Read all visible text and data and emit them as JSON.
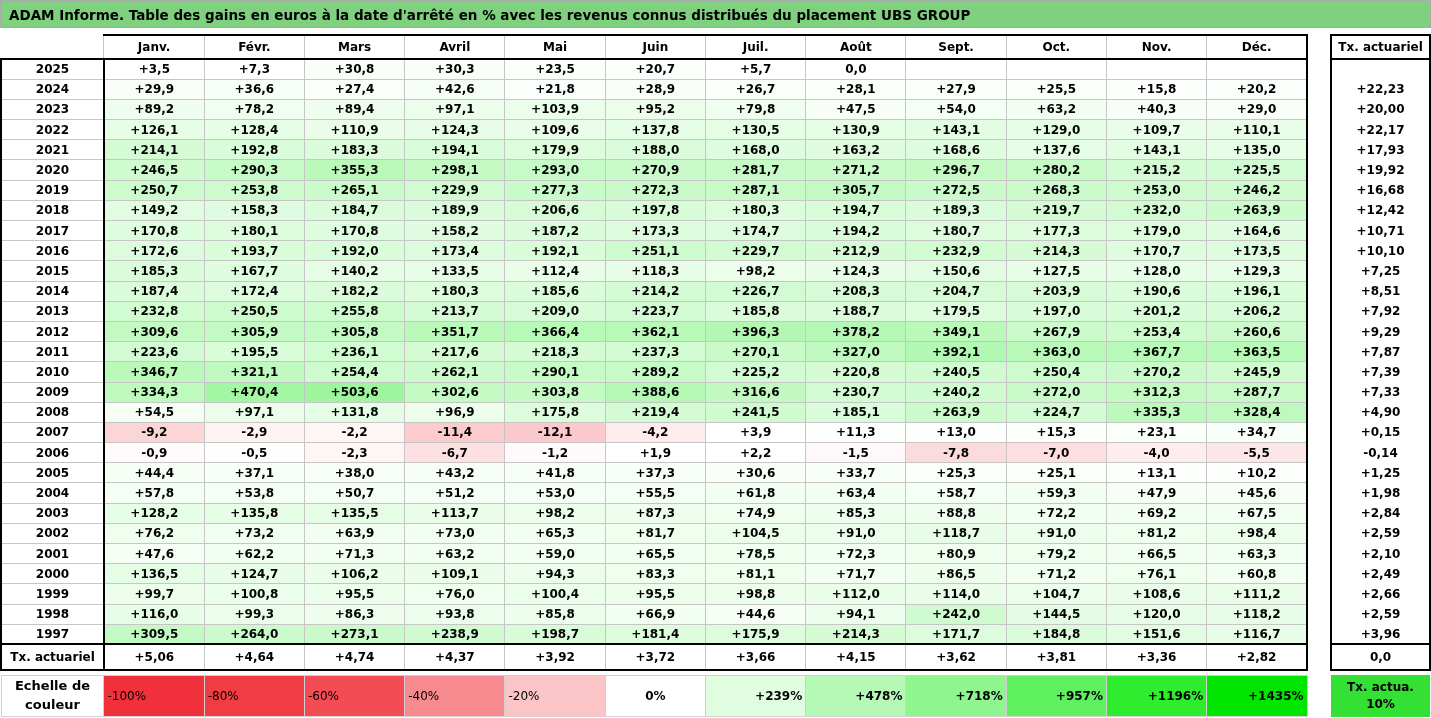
{
  "title": "ADAM Informe. Table des gains en euros à la date d'arrêté en % avec les revenus connus distribués du placement UBS GROUP",
  "columns": [
    "Janv.",
    "Févr.",
    "Mars",
    "Avril",
    "Mai",
    "Juin",
    "Juil.",
    "Août",
    "Sept.",
    "Oct.",
    "Nov.",
    "Déc."
  ],
  "rate_column": "Tx. actuariel",
  "rows": [
    {
      "year": "2025",
      "values": [
        "+3,5",
        "+7,3",
        "+30,8",
        "+30,3",
        "+23,5",
        "+20,7",
        "+5,7",
        "0,0"
      ]
    },
    {
      "year": "2024",
      "values": [
        "+29,9",
        "+36,6",
        "+27,4",
        "+42,6",
        "+21,8",
        "+28,9",
        "+26,7",
        "+28,1",
        "+27,9",
        "+25,5",
        "+15,8",
        "+20,2"
      ],
      "rate": "+22,23"
    },
    {
      "year": "2023",
      "values": [
        "+89,2",
        "+78,2",
        "+89,4",
        "+97,1",
        "+103,9",
        "+95,2",
        "+79,8",
        "+47,5",
        "+54,0",
        "+63,2",
        "+40,3",
        "+29,0"
      ],
      "rate": "+20,00"
    },
    {
      "year": "2022",
      "values": [
        "+126,1",
        "+128,4",
        "+110,9",
        "+124,3",
        "+109,6",
        "+137,8",
        "+130,5",
        "+130,9",
        "+143,1",
        "+129,0",
        "+109,7",
        "+110,1"
      ],
      "rate": "+22,17"
    },
    {
      "year": "2021",
      "values": [
        "+214,1",
        "+192,8",
        "+183,3",
        "+194,1",
        "+179,9",
        "+188,0",
        "+168,0",
        "+163,2",
        "+168,6",
        "+137,6",
        "+143,1",
        "+135,0"
      ],
      "rate": "+17,93"
    },
    {
      "year": "2020",
      "values": [
        "+246,5",
        "+290,3",
        "+355,3",
        "+298,1",
        "+293,0",
        "+270,9",
        "+281,7",
        "+271,2",
        "+296,7",
        "+280,2",
        "+215,2",
        "+225,5"
      ],
      "rate": "+19,92"
    },
    {
      "year": "2019",
      "values": [
        "+250,7",
        "+253,8",
        "+265,1",
        "+229,9",
        "+277,3",
        "+272,3",
        "+287,1",
        "+305,7",
        "+272,5",
        "+268,3",
        "+253,0",
        "+246,2"
      ],
      "rate": "+16,68"
    },
    {
      "year": "2018",
      "values": [
        "+149,2",
        "+158,3",
        "+184,7",
        "+189,9",
        "+206,6",
        "+197,8",
        "+180,3",
        "+194,7",
        "+189,3",
        "+219,7",
        "+232,0",
        "+263,9"
      ],
      "rate": "+12,42"
    },
    {
      "year": "2017",
      "values": [
        "+170,8",
        "+180,1",
        "+170,8",
        "+158,2",
        "+187,2",
        "+173,3",
        "+174,7",
        "+194,2",
        "+180,7",
        "+177,3",
        "+179,0",
        "+164,6"
      ],
      "rate": "+10,71"
    },
    {
      "year": "2016",
      "values": [
        "+172,6",
        "+193,7",
        "+192,0",
        "+173,4",
        "+192,1",
        "+251,1",
        "+229,7",
        "+212,9",
        "+232,9",
        "+214,3",
        "+170,7",
        "+173,5"
      ],
      "rate": "+10,10"
    },
    {
      "year": "2015",
      "values": [
        "+185,3",
        "+167,7",
        "+140,2",
        "+133,5",
        "+112,4",
        "+118,3",
        "+98,2",
        "+124,3",
        "+150,6",
        "+127,5",
        "+128,0",
        "+129,3"
      ],
      "rate": "+7,25"
    },
    {
      "year": "2014",
      "values": [
        "+187,4",
        "+172,4",
        "+182,2",
        "+180,3",
        "+185,6",
        "+214,2",
        "+226,7",
        "+208,3",
        "+204,7",
        "+203,9",
        "+190,6",
        "+196,1"
      ],
      "rate": "+8,51"
    },
    {
      "year": "2013",
      "values": [
        "+232,8",
        "+250,5",
        "+255,8",
        "+213,7",
        "+209,0",
        "+223,7",
        "+185,8",
        "+188,7",
        "+179,5",
        "+197,0",
        "+201,2",
        "+206,2"
      ],
      "rate": "+7,92"
    },
    {
      "year": "2012",
      "values": [
        "+309,6",
        "+305,9",
        "+305,8",
        "+351,7",
        "+366,4",
        "+362,1",
        "+396,3",
        "+378,2",
        "+349,1",
        "+267,9",
        "+253,4",
        "+260,6"
      ],
      "rate": "+9,29"
    },
    {
      "year": "2011",
      "values": [
        "+223,6",
        "+195,5",
        "+236,1",
        "+217,6",
        "+218,3",
        "+237,3",
        "+270,1",
        "+327,0",
        "+392,1",
        "+363,0",
        "+367,7",
        "+363,5"
      ],
      "rate": "+7,87"
    },
    {
      "year": "2010",
      "values": [
        "+346,7",
        "+321,1",
        "+254,4",
        "+262,1",
        "+290,1",
        "+289,2",
        "+225,2",
        "+220,8",
        "+240,5",
        "+250,4",
        "+270,2",
        "+245,9"
      ],
      "rate": "+7,39"
    },
    {
      "year": "2009",
      "values": [
        "+334,3",
        "+470,4",
        "+503,6",
        "+302,6",
        "+303,8",
        "+388,6",
        "+316,6",
        "+230,7",
        "+240,2",
        "+272,0",
        "+312,3",
        "+287,7"
      ],
      "rate": "+7,33"
    },
    {
      "year": "2008",
      "values": [
        "+54,5",
        "+97,1",
        "+131,8",
        "+96,9",
        "+175,8",
        "+219,4",
        "+241,5",
        "+185,1",
        "+263,9",
        "+224,7",
        "+335,3",
        "+328,4"
      ],
      "rate": "+4,90"
    },
    {
      "year": "2007",
      "values": [
        "-9,2",
        "-2,9",
        "-2,2",
        "-11,4",
        "-12,1",
        "-4,2",
        "+3,9",
        "+11,3",
        "+13,0",
        "+15,3",
        "+23,1",
        "+34,7"
      ],
      "rate": "+0,15"
    },
    {
      "year": "2006",
      "values": [
        "-0,9",
        "-0,5",
        "-2,3",
        "-6,7",
        "-1,2",
        "+1,9",
        "+2,2",
        "-1,5",
        "-7,8",
        "-7,0",
        "-4,0",
        "-5,5"
      ],
      "rate": "-0,14"
    },
    {
      "year": "2005",
      "values": [
        "+44,4",
        "+37,1",
        "+38,0",
        "+43,2",
        "+41,8",
        "+37,3",
        "+30,6",
        "+33,7",
        "+25,3",
        "+25,1",
        "+13,1",
        "+10,2"
      ],
      "rate": "+1,25"
    },
    {
      "year": "2004",
      "values": [
        "+57,8",
        "+53,8",
        "+50,7",
        "+51,2",
        "+53,0",
        "+55,5",
        "+61,8",
        "+63,4",
        "+58,7",
        "+59,3",
        "+47,9",
        "+45,6"
      ],
      "rate": "+1,98"
    },
    {
      "year": "2003",
      "values": [
        "+128,2",
        "+135,8",
        "+135,5",
        "+113,7",
        "+98,2",
        "+87,3",
        "+74,9",
        "+85,3",
        "+88,8",
        "+72,2",
        "+69,2",
        "+67,5"
      ],
      "rate": "+2,84"
    },
    {
      "year": "2002",
      "values": [
        "+76,2",
        "+73,2",
        "+63,9",
        "+73,0",
        "+65,3",
        "+81,7",
        "+104,5",
        "+91,0",
        "+118,7",
        "+91,0",
        "+81,2",
        "+98,4"
      ],
      "rate": "+2,59"
    },
    {
      "year": "2001",
      "values": [
        "+47,6",
        "+62,2",
        "+71,3",
        "+63,2",
        "+59,0",
        "+65,5",
        "+78,5",
        "+72,3",
        "+80,9",
        "+79,2",
        "+66,5",
        "+63,3"
      ],
      "rate": "+2,10"
    },
    {
      "year": "2000",
      "values": [
        "+136,5",
        "+124,7",
        "+106,2",
        "+109,1",
        "+94,3",
        "+83,3",
        "+81,1",
        "+71,7",
        "+86,5",
        "+71,2",
        "+76,1",
        "+60,8"
      ],
      "rate": "+2,49"
    },
    {
      "year": "1999",
      "values": [
        "+99,7",
        "+100,8",
        "+95,5",
        "+76,0",
        "+100,4",
        "+95,5",
        "+98,8",
        "+112,0",
        "+114,0",
        "+104,7",
        "+108,6",
        "+111,2"
      ],
      "rate": "+2,66"
    },
    {
      "year": "1998",
      "values": [
        "+116,0",
        "+99,3",
        "+86,3",
        "+93,8",
        "+85,8",
        "+66,9",
        "+44,6",
        "+94,1",
        "+242,0",
        "+144,5",
        "+120,0",
        "+118,2"
      ],
      "rate": "+2,59"
    },
    {
      "year": "1997",
      "values": [
        "+309,5",
        "+264,0",
        "+273,1",
        "+238,9",
        "+198,7",
        "+181,4",
        "+175,9",
        "+214,3",
        "+171,7",
        "+184,8",
        "+151,6",
        "+116,7"
      ],
      "rate": "+3,96"
    }
  ],
  "summary": {
    "label": "Tx. actuariel",
    "values": [
      "+5,06",
      "+4,64",
      "+4,74",
      "+4,37",
      "+3,92",
      "+3,72",
      "+3,66",
      "+4,15",
      "+3,62",
      "+3,81",
      "+3,36",
      "+2,82"
    ],
    "rate": "0,0"
  },
  "scale": {
    "label": "Echelle de couleur",
    "steps": [
      {
        "label": "-100%",
        "color": "#f0303a"
      },
      {
        "label": "-80%",
        "color": "#f23c44"
      },
      {
        "label": "-60%",
        "color": "#f44c54"
      },
      {
        "label": "-40%",
        "color": "#f78a8e"
      },
      {
        "label": "-20%",
        "color": "#fbc4c6"
      },
      {
        "label": "0%",
        "color": "#ffffff"
      },
      {
        "label": "+239%",
        "color": "#e0fde0"
      },
      {
        "label": "+478%",
        "color": "#b6f8b6"
      },
      {
        "label": "+718%",
        "color": "#8ff58f"
      },
      {
        "label": "+957%",
        "color": "#5ef05e"
      },
      {
        "label": "+1196%",
        "color": "#2fec2f"
      },
      {
        "label": "+1435%",
        "color": "#00e600"
      }
    ],
    "rate_step": {
      "label": "Tx. actua. 10%",
      "color": "#33e033"
    }
  }
}
